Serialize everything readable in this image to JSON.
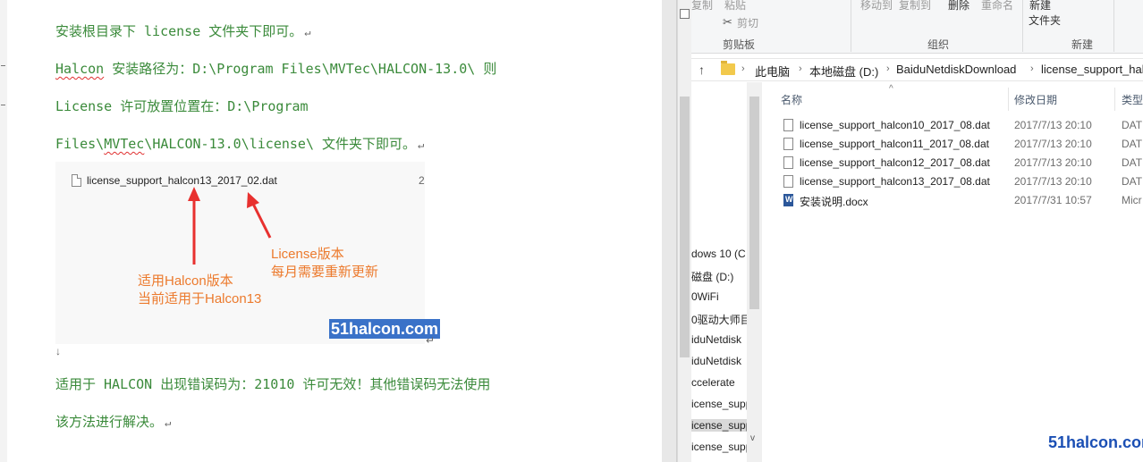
{
  "document": {
    "lines": [
      {
        "text": "安装根目录下 license 文件夹下即可。"
      },
      {
        "pre": "",
        "squiggle": "Halcon",
        "post": " 安装路径为：D:\\Program Files\\MVTec\\HALCON-13.0\\ 则"
      },
      {
        "text": "License 许可放置位置在：D:\\Program"
      },
      {
        "pre": "Files\\",
        "squiggle": "MVTec",
        "post": "\\HALCON-13.0\\license\\ 文件夹下即可。"
      },
      {
        "text": "适用于 HALCON 出现错误码为：21010 许可无效！其他错误码无法使用"
      },
      {
        "text": "该方法进行解决。"
      }
    ],
    "paragraph_mark": "↵",
    "return_mark": "↵",
    "embedded_image": {
      "file_name": "license_support_halcon13_2017_02.dat",
      "truncated_column": "2",
      "annotation_license_1": "License版本",
      "annotation_license_2": "每月需要重新更新",
      "annotation_version_1": "适用Halcon版本",
      "annotation_version_2": "当前适用于Halcon13",
      "watermark": "51halcon.com",
      "annotation_color": "#ec7a2d",
      "arrow_color": "#e8312f"
    }
  },
  "explorer": {
    "ribbon": {
      "paste": "粘贴",
      "cut": "剪切",
      "clipboard_group": "剪贴板",
      "move_to": "移动到",
      "copy_to": "复制到",
      "delete": "删除",
      "rename": "重命名",
      "organize_group": "组织",
      "new_item": "新建",
      "new_folder": "文件夹",
      "new_group": "新建",
      "copy_cut": "复制"
    },
    "breadcrumb": [
      "此电脑",
      "本地磁盘 (D:)",
      "BaiduNetdiskDownload",
      "license_support_halc"
    ],
    "nav_items": [
      "dows 10 (C",
      "磁盘 (D:)",
      "0WiFi",
      "0驱动大师目",
      "iduNetdisk",
      "iduNetdisk",
      "ccelerate",
      "icense_supp",
      "icense_supp",
      "icense_supp"
    ],
    "columns": {
      "name": "名称",
      "modified": "修改日期",
      "type": "类型"
    },
    "files": [
      {
        "name": "license_support_halcon10_2017_08.dat",
        "date": "2017/7/13 20:10",
        "type": "DAT",
        "icon": "file-icon"
      },
      {
        "name": "license_support_halcon11_2017_08.dat",
        "date": "2017/7/13 20:10",
        "type": "DAT",
        "icon": "file-icon"
      },
      {
        "name": "license_support_halcon12_2017_08.dat",
        "date": "2017/7/13 20:10",
        "type": "DAT",
        "icon": "file-icon"
      },
      {
        "name": "license_support_halcon13_2017_08.dat",
        "date": "2017/7/13 20:10",
        "type": "DAT",
        "icon": "file-icon"
      },
      {
        "name": "安装说明.docx",
        "date": "2017/7/31 10:57",
        "type": "Micr",
        "icon": "word-doc-icon"
      }
    ]
  },
  "watermark": "51halcon.com",
  "colors": {
    "doc_text": "#3a8a3a",
    "watermark_blue": "#1b4fb4"
  }
}
